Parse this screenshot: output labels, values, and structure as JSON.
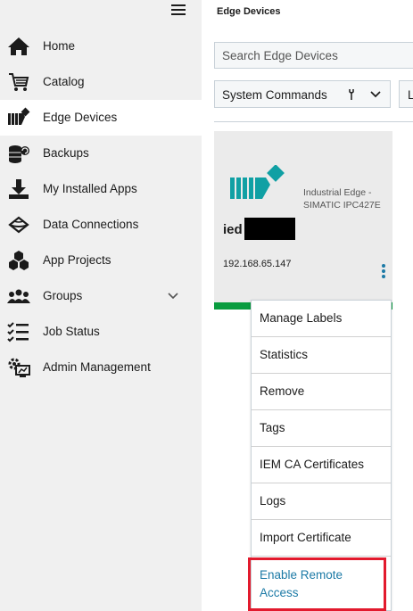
{
  "sidebar": {
    "items": [
      {
        "label": "Home",
        "icon": "home-icon"
      },
      {
        "label": "Catalog",
        "icon": "shopping-cart-icon"
      },
      {
        "label": "Edge Devices",
        "icon": "edge-device-icon",
        "active": true
      },
      {
        "label": "Backups",
        "icon": "backup-icon"
      },
      {
        "label": "My Installed Apps",
        "icon": "download-icon"
      },
      {
        "label": "Data Connections",
        "icon": "data-connection-icon"
      },
      {
        "label": "App Projects",
        "icon": "cubes-icon"
      },
      {
        "label": "Groups",
        "icon": "group-icon"
      },
      {
        "label": "Job Status",
        "icon": "checklist-icon"
      },
      {
        "label": "Admin Management",
        "icon": "admin-gear-icon"
      }
    ]
  },
  "header": {
    "title": "Edge Devices"
  },
  "search": {
    "placeholder": "Search Edge Devices"
  },
  "filters": {
    "commands_label": "System Commands",
    "second_label": "L"
  },
  "device": {
    "name": "ied",
    "type": "Industrial Edge - SIMATIC IPC427E",
    "ip": "192.168.65.147",
    "status_color": "#0a9c3f"
  },
  "context_menu": {
    "items": [
      "Manage Labels",
      "Statistics",
      "Remove",
      "Tags",
      "IEM CA Certificates",
      "Logs",
      "Import Certificate",
      "Enable Remote Access"
    ],
    "highlight_color": "#e21a2d",
    "link_color": "#1c7aa6"
  }
}
